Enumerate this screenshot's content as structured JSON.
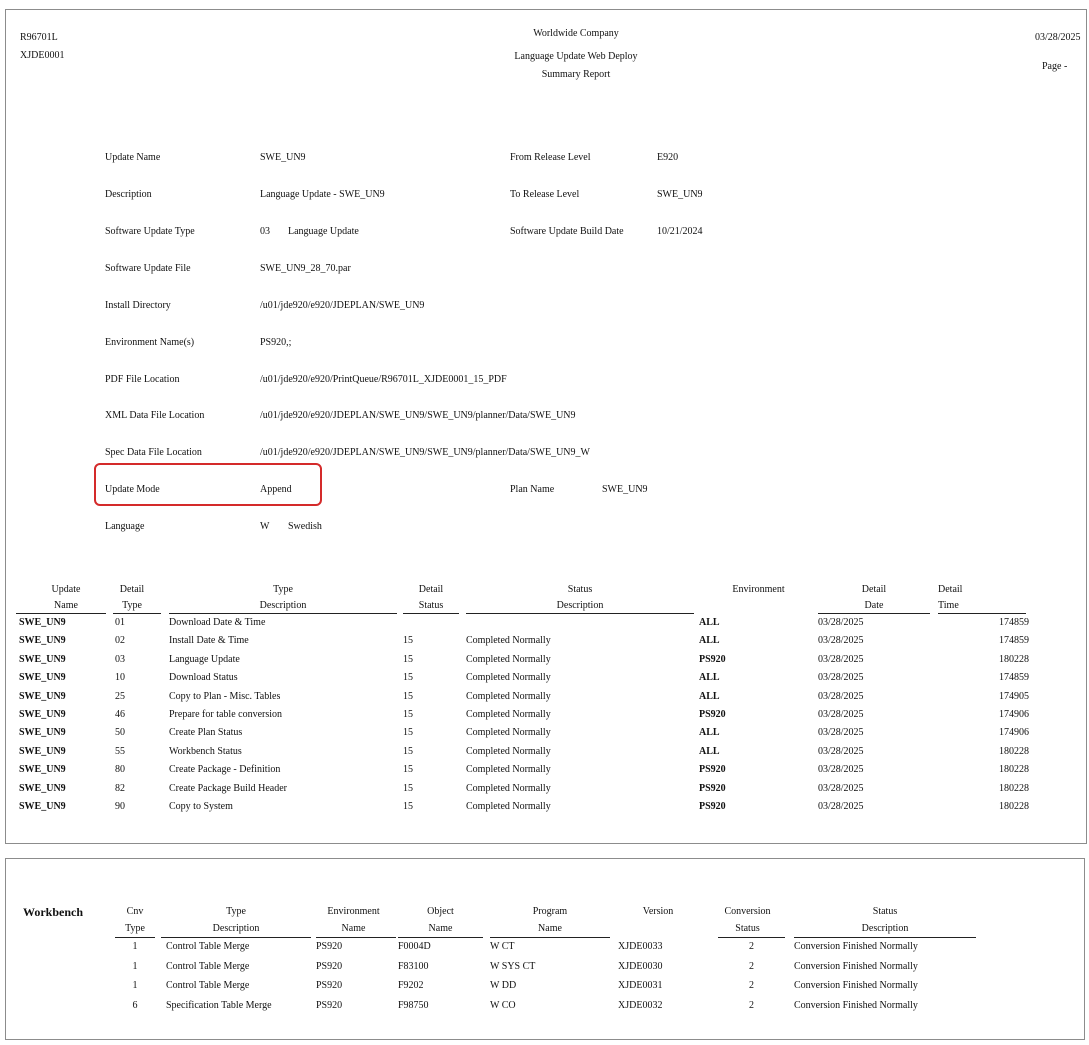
{
  "header": {
    "report_id": "R96701L",
    "version": "XJDE0001",
    "company": "Worldwide Company",
    "title": "Language Update Web Deploy",
    "subtitle": "Summary Report",
    "date": "03/28/2025",
    "page_label": "Page -"
  },
  "fields": {
    "update_name": {
      "label": "Update Name",
      "value": "SWE_UN9"
    },
    "description": {
      "label": "Description",
      "value": "Language Update - SWE_UN9"
    },
    "sw_update_type": {
      "label": "Software Update Type",
      "code": "03",
      "value": "Language Update"
    },
    "sw_update_file": {
      "label": "Software Update File",
      "value": "SWE_UN9_28_70.par"
    },
    "install_dir": {
      "label": "Install Directory",
      "value": "/u01/jde920/e920/JDEPLAN/SWE_UN9"
    },
    "env_names": {
      "label": "Environment Name(s)",
      "value": "PS920,;"
    },
    "pdf_location": {
      "label": "PDF File Location",
      "value": "/u01/jde920/e920/PrintQueue/R96701L_XJDE0001_15_PDF"
    },
    "xml_location": {
      "label": "XML Data File Location",
      "value": "/u01/jde920/e920/JDEPLAN/SWE_UN9/SWE_UN9/planner/Data/SWE_UN9"
    },
    "spec_location": {
      "label": "Spec Data File Location",
      "value": "/u01/jde920/e920/JDEPLAN/SWE_UN9/SWE_UN9/planner/Data/SWE_UN9_W"
    },
    "update_mode": {
      "label": "Update Mode",
      "value": "Append"
    },
    "language": {
      "label": "Language",
      "code": "W",
      "value": "Swedish"
    },
    "from_release": {
      "label": "From Release Level",
      "value": "E920"
    },
    "to_release": {
      "label": "To Release Level",
      "value": "SWE_UN9"
    },
    "build_date": {
      "label": "Software Update Build Date",
      "value": "10/21/2024"
    },
    "plan_name": {
      "label": "Plan Name",
      "value": "SWE_UN9"
    }
  },
  "detail_table": {
    "headers": [
      {
        "top": "Update",
        "bottom": "Name"
      },
      {
        "top": "Detail",
        "bottom": "Type"
      },
      {
        "top": "Type",
        "bottom": "Description"
      },
      {
        "top": "Detail",
        "bottom": "Status"
      },
      {
        "top": "Status",
        "bottom": "Description"
      },
      {
        "top": "Environment",
        "bottom": ""
      },
      {
        "top": "Detail",
        "bottom": "Date"
      },
      {
        "top": "Detail",
        "bottom": "Time"
      }
    ],
    "rows": [
      [
        "SWE_UN9",
        "01",
        "Download Date & Time",
        "",
        "",
        "ALL",
        "03/28/2025",
        "174859"
      ],
      [
        "SWE_UN9",
        "02",
        "Install Date & Time",
        "15",
        "Completed Normally",
        "ALL",
        "03/28/2025",
        "174859"
      ],
      [
        "SWE_UN9",
        "03",
        "Language Update",
        "15",
        "Completed Normally",
        "PS920",
        "03/28/2025",
        "180228"
      ],
      [
        "SWE_UN9",
        "10",
        "Download Status",
        "15",
        "Completed Normally",
        "ALL",
        "03/28/2025",
        "174859"
      ],
      [
        "SWE_UN9",
        "25",
        "Copy to Plan - Misc. Tables",
        "15",
        "Completed Normally",
        "ALL",
        "03/28/2025",
        "174905"
      ],
      [
        "SWE_UN9",
        "46",
        "Prepare for table conversion",
        "15",
        "Completed Normally",
        "PS920",
        "03/28/2025",
        "174906"
      ],
      [
        "SWE_UN9",
        "50",
        "Create Plan Status",
        "15",
        "Completed Normally",
        "ALL",
        "03/28/2025",
        "174906"
      ],
      [
        "SWE_UN9",
        "55",
        "Workbench Status",
        "15",
        "Completed Normally",
        "ALL",
        "03/28/2025",
        "180228"
      ],
      [
        "SWE_UN9",
        "80",
        "Create Package - Definition",
        "15",
        "Completed Normally",
        "PS920",
        "03/28/2025",
        "180228"
      ],
      [
        "SWE_UN9",
        "82",
        "Create Package Build Header",
        "15",
        "Completed Normally",
        "PS920",
        "03/28/2025",
        "180228"
      ],
      [
        "SWE_UN9",
        "90",
        "Copy to System",
        "15",
        "Completed Normally",
        "PS920",
        "03/28/2025",
        "180228"
      ]
    ]
  },
  "workbench": {
    "title": "Workbench",
    "headers": [
      {
        "top": "Cnv",
        "bottom": "Type"
      },
      {
        "top": "Type",
        "bottom": "Description"
      },
      {
        "top": "Environment",
        "bottom": "Name"
      },
      {
        "top": "Object",
        "bottom": "Name"
      },
      {
        "top": "Program",
        "bottom": "Name"
      },
      {
        "top": "Version",
        "bottom": ""
      },
      {
        "top": "Conversion",
        "bottom": "Status"
      },
      {
        "top": "Status",
        "bottom": "Description"
      }
    ],
    "rows": [
      [
        "1",
        "Control Table Merge",
        "PS920",
        "F0004D",
        "W CT",
        "XJDE0033",
        "2",
        "Conversion Finished Normally"
      ],
      [
        "1",
        "Control Table Merge",
        "PS920",
        "F83100",
        "W SYS CT",
        "XJDE0030",
        "2",
        "Conversion Finished Normally"
      ],
      [
        "1",
        "Control Table Merge",
        "PS920",
        "F9202",
        "W DD",
        "XJDE0031",
        "2",
        "Conversion Finished Normally"
      ],
      [
        "6",
        "Specification Table Merge",
        "PS920",
        "F98750",
        "W CO",
        "XJDE0032",
        "2",
        "Conversion Finished Normally"
      ]
    ]
  },
  "colors": {
    "highlight": "#d42a2a",
    "border": "#8c8c8c",
    "text": "#111111"
  }
}
